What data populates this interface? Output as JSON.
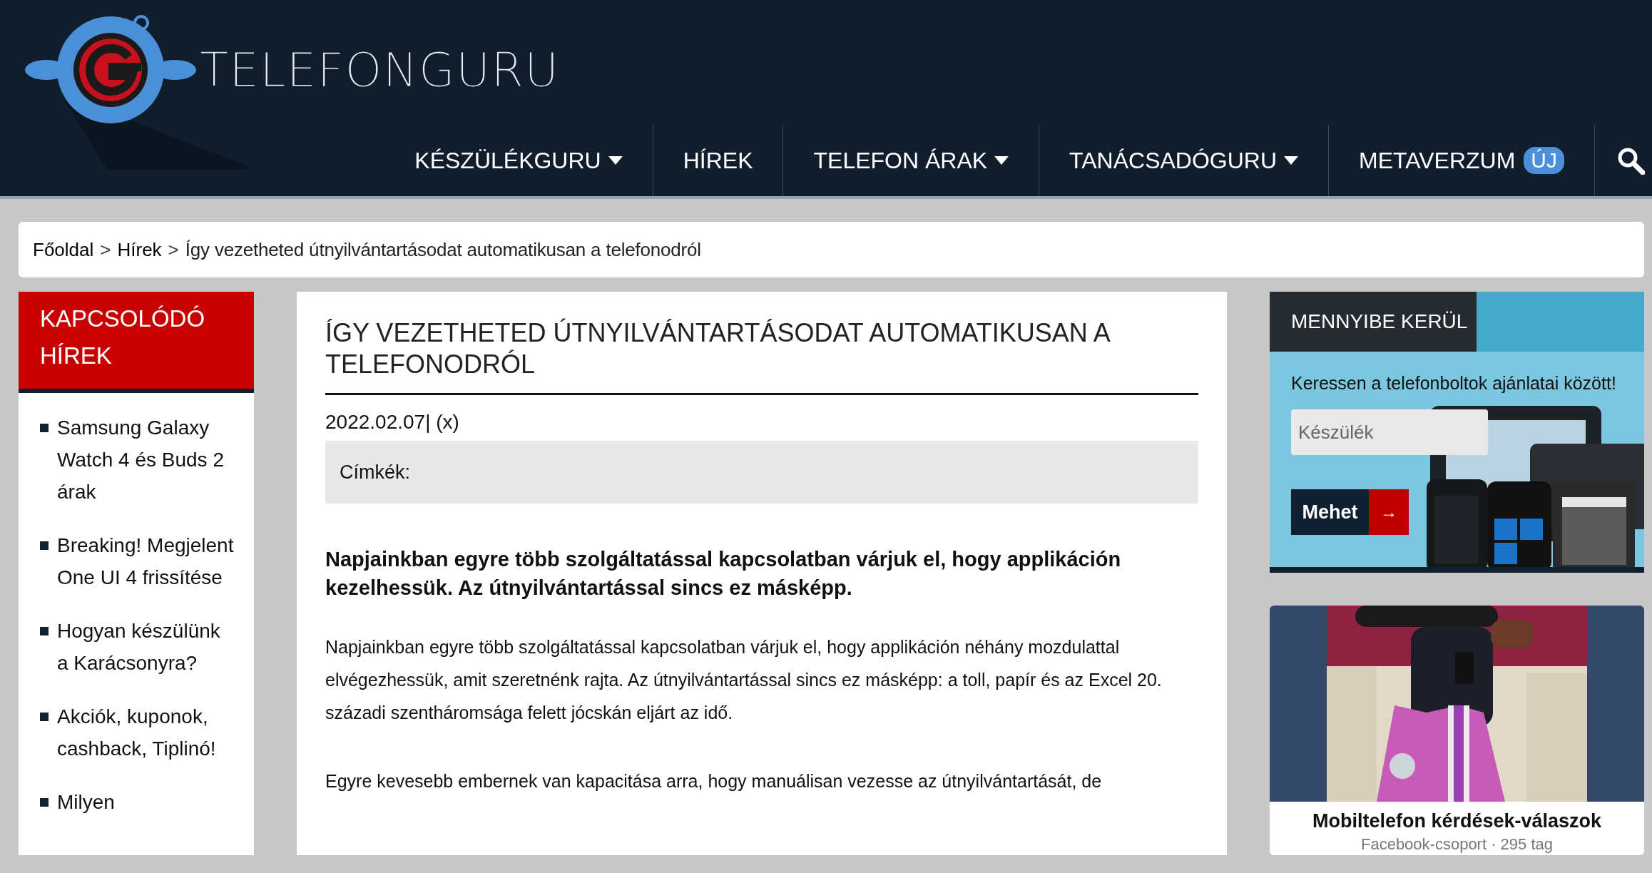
{
  "header": {
    "logo_text": "TELEFONGURU",
    "nav": [
      {
        "label": "KÉSZÜLÉKGURU",
        "dropdown": true
      },
      {
        "label": "HÍREK",
        "dropdown": false
      },
      {
        "label": "TELEFON ÁRAK",
        "dropdown": true
      },
      {
        "label": "TANÁCSADÓGURU",
        "dropdown": true
      },
      {
        "label": "METAVERZUM",
        "dropdown": false,
        "badge": "ÚJ"
      }
    ]
  },
  "breadcrumb": [
    {
      "kind": "link",
      "text": "Főoldal"
    },
    {
      "kind": "separator",
      "text": ">"
    },
    {
      "kind": "link",
      "text": "Hírek"
    },
    {
      "kind": "separator",
      "text": ">"
    },
    {
      "kind": "current",
      "text": "Így vezetheted útnyilvántartásodat automatikusan a telefonodról"
    }
  ],
  "sidebar": {
    "title": "KAPCSOLÓDÓ HÍREK",
    "items": [
      "Samsung Galaxy Watch 4 és Buds 2 árak",
      "Breaking! Megjelent One UI 4 frissítése",
      "Hogyan készülünk a Karácsonyra?",
      "Akciók, kuponok, cashback, Tiplinó!",
      "Milyen"
    ]
  },
  "article": {
    "title": "ÍGY VEZETHETED ÚTNYILVÁNTARTÁSODAT AUTOMATIKUSAN A TELEFONODRÓL",
    "date": "2022.02.07| (x)",
    "tags_label": "Címkék:",
    "lead": "Napjainkban egyre több szolgáltatással kapcsolatban várjuk el, hogy applikáción kezelhessük. Az útnyilvántartással sincs ez másképp.",
    "paragraphs": [
      "Napjainkban egyre több szolgáltatással kapcsolatban várjuk el, hogy applikáción néhány mozdulattal elvégezhessük, amit szeretnénk rajta. Az útnyilvántartással sincs ez másképp: a toll, papír és az Excel 20. századi szentháromsága felett jócskán eljárt az idő.",
      "Egyre kevesebb embernek van kapacitása arra, hogy manuálisan vezesse az útnyilvántartását, de"
    ]
  },
  "price_widget": {
    "title": "MENNYIBE KERÜL",
    "prompt": "Keressen a telefonboltok ajánlatai között!",
    "placeholder": "Készülék",
    "button": "Mehet",
    "button_arrow": "→"
  },
  "facebook_card": {
    "name": "Mobiltelefon kérdések-válaszok",
    "meta": "Facebook-csoport · 295 tag"
  }
}
